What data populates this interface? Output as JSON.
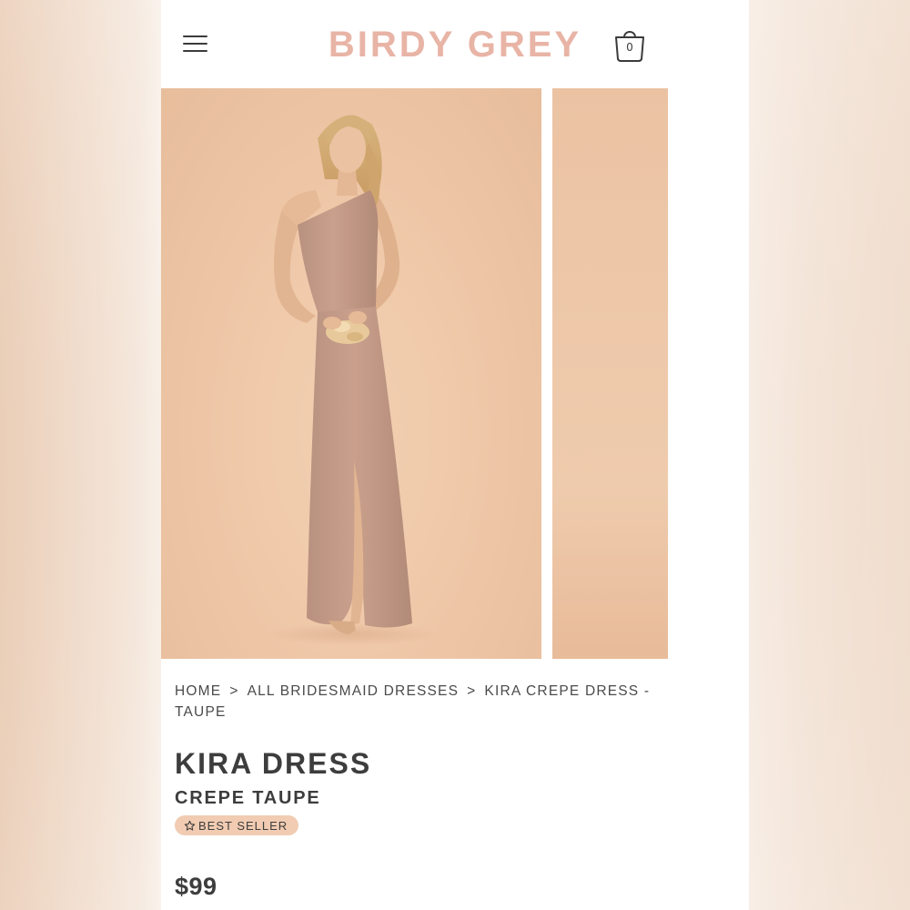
{
  "header": {
    "logo": "BIRDY GREY",
    "menu_icon": "hamburger-menu-icon",
    "cart_icon": "shopping-bag-icon",
    "cart_count": "0"
  },
  "gallery": {
    "images": [
      "model-photo-front",
      "model-photo-side"
    ]
  },
  "breadcrumb": {
    "items": [
      "HOME",
      "ALL BRIDESMAID DRESSES",
      "KIRA CREPE DRESS - TAUPE"
    ],
    "separator": ">"
  },
  "product": {
    "title": "KIRA DRESS",
    "subtitle": "CREPE TAUPE",
    "badge": "BEST SELLER",
    "badge_icon": "star-outline-icon",
    "price": "$99"
  },
  "colors": {
    "brand": "#e8b4a6",
    "text": "#3d3d3d",
    "badge_bg": "#f1ccb2",
    "photo_bg": "#eec6a6",
    "dress": "#c79e8b"
  }
}
